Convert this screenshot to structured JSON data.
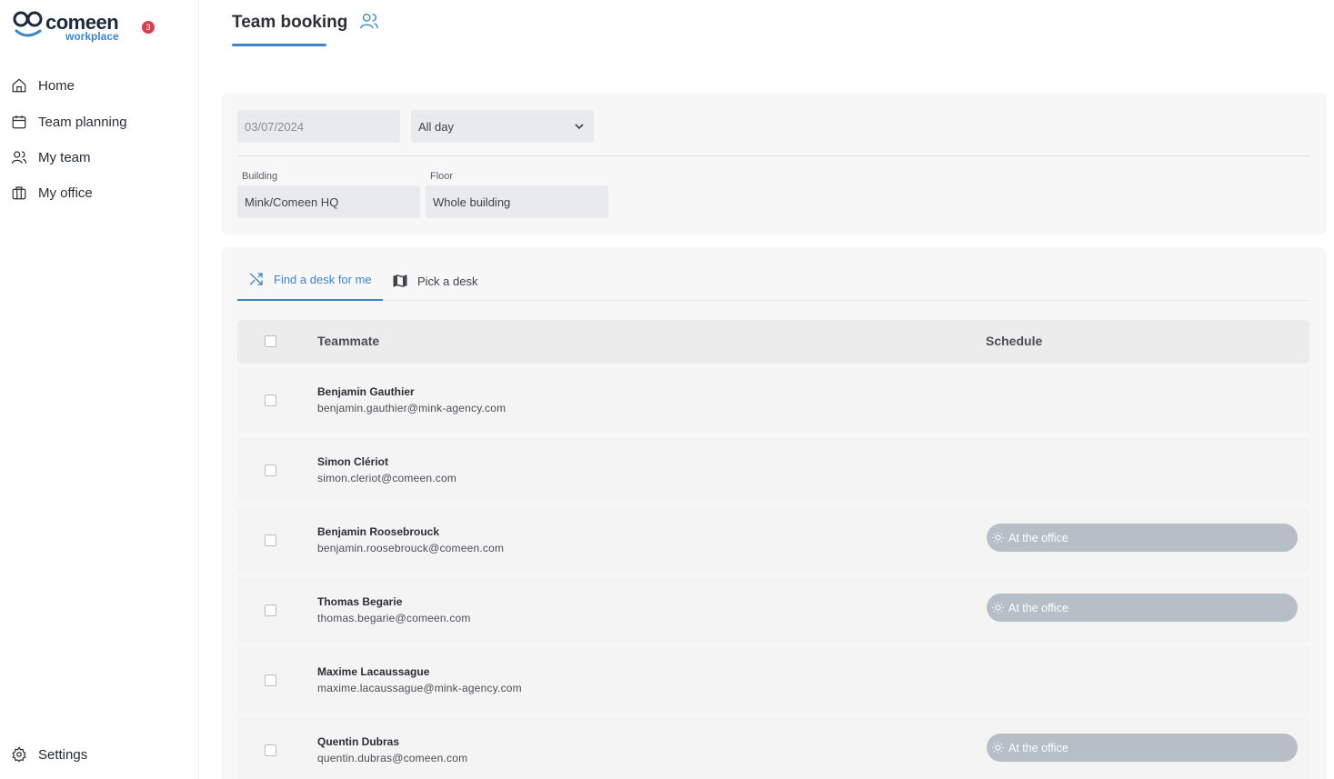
{
  "app": {
    "brand": "comeen",
    "brand_sub": "workplace",
    "notification_count": "3"
  },
  "sidebar": {
    "items": [
      {
        "label": "Home",
        "icon": "home-icon"
      },
      {
        "label": "Team planning",
        "icon": "calendar-icon"
      },
      {
        "label": "My team",
        "icon": "users-icon"
      },
      {
        "label": "My office",
        "icon": "briefcase-icon"
      }
    ],
    "settings_label": "Settings"
  },
  "header": {
    "title": "Team booking",
    "icon": "users-icon"
  },
  "filters": {
    "date_placeholder": "03/07/2024",
    "period_value": "All day",
    "building_label": "Building",
    "building_value": "Mink/Comeen HQ",
    "floor_label": "Floor",
    "floor_value": "Whole building"
  },
  "tabs": [
    {
      "label": "Find a desk for me",
      "icon": "shuffle-icon"
    },
    {
      "label": "Pick a desk",
      "icon": "map-icon"
    }
  ],
  "table": {
    "columns": [
      "Teammate",
      "Schedule"
    ],
    "rows": [
      {
        "name": "Benjamin Gauthier",
        "email": "benjamin.gauthier@mink-agency.com",
        "status": ""
      },
      {
        "name": "Simon Clériot",
        "email": "simon.cleriot@comeen.com",
        "status": ""
      },
      {
        "name": "Benjamin Roosebrouck",
        "email": "benjamin.roosebrouck@comeen.com",
        "status": "At the office"
      },
      {
        "name": "Thomas Begarie",
        "email": "thomas.begarie@comeen.com",
        "status": "At the office"
      },
      {
        "name": "Maxime Lacaussague",
        "email": "maxime.lacaussague@mink-agency.com",
        "status": ""
      },
      {
        "name": "Quentin Dubras",
        "email": "quentin.dubras@comeen.com",
        "status": "At the office"
      }
    ]
  },
  "colors": {
    "accent": "#3d86c6",
    "notification": "#d6404f",
    "status_pill": "#b6bec7"
  }
}
